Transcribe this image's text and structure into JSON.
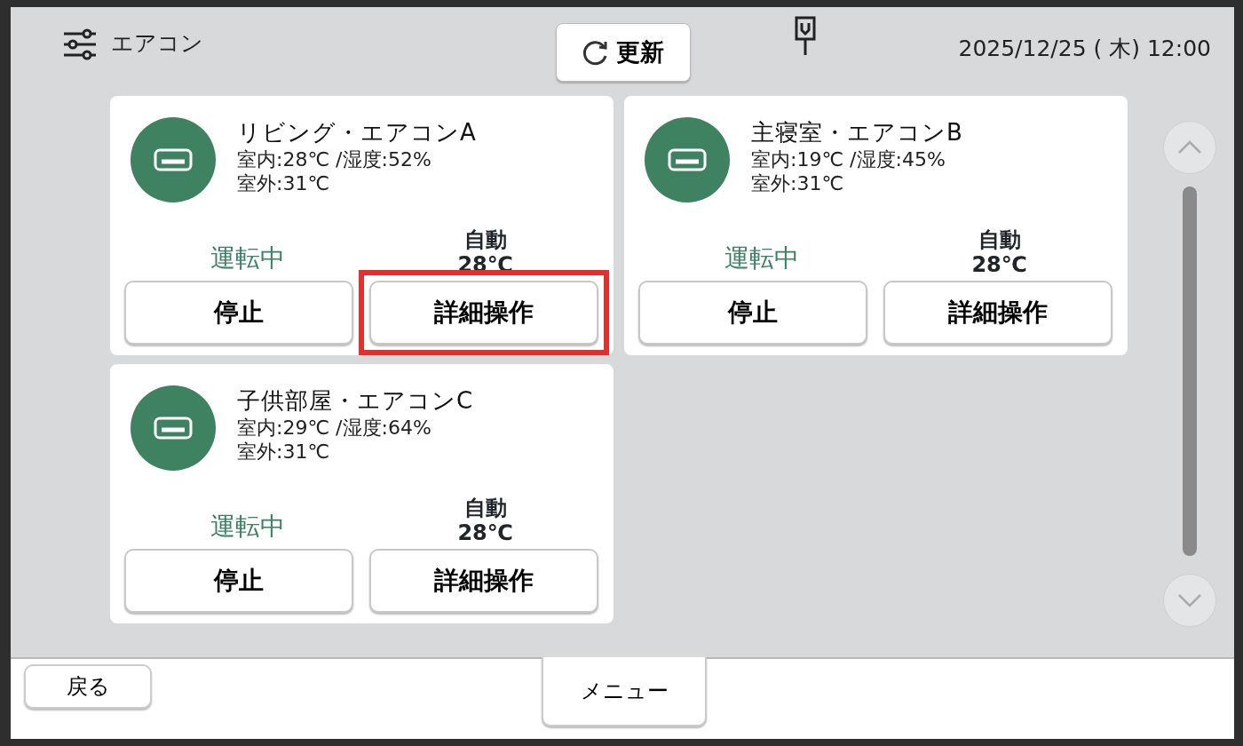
{
  "header": {
    "title": "エアコン",
    "refresh_button": "更新",
    "datetime": "2025/12/25 ( 木) 12:00"
  },
  "units": [
    {
      "name": "リビング・エアコンA",
      "indoor": "室内:28℃ /湿度:52%",
      "outdoor": "室外:31℃",
      "status": "運転中",
      "mode": "自動",
      "setpoint": "28℃",
      "buttons": [
        {
          "label": "停止",
          "highlighted": false
        },
        {
          "label": "詳細操作",
          "highlighted": true
        }
      ]
    },
    {
      "name": "主寝室・エアコンB",
      "indoor": "室内:19℃ /湿度:45%",
      "outdoor": "室外:31℃",
      "status": "運転中",
      "mode": "自動",
      "setpoint": "28℃",
      "buttons": [
        {
          "label": "停止",
          "highlighted": false
        },
        {
          "label": "詳細操作",
          "highlighted": false
        }
      ]
    },
    {
      "name": "子供部屋・エアコンC",
      "indoor": "室内:29℃ /湿度:64%",
      "outdoor": "室外:31℃",
      "status": "運転中",
      "mode": "自動",
      "setpoint": "28℃",
      "buttons": [
        {
          "label": "停止",
          "highlighted": false
        },
        {
          "label": "詳細操作",
          "highlighted": false
        }
      ]
    }
  ],
  "footer": {
    "back_button": "戻る",
    "menu_button": "メニュー"
  }
}
